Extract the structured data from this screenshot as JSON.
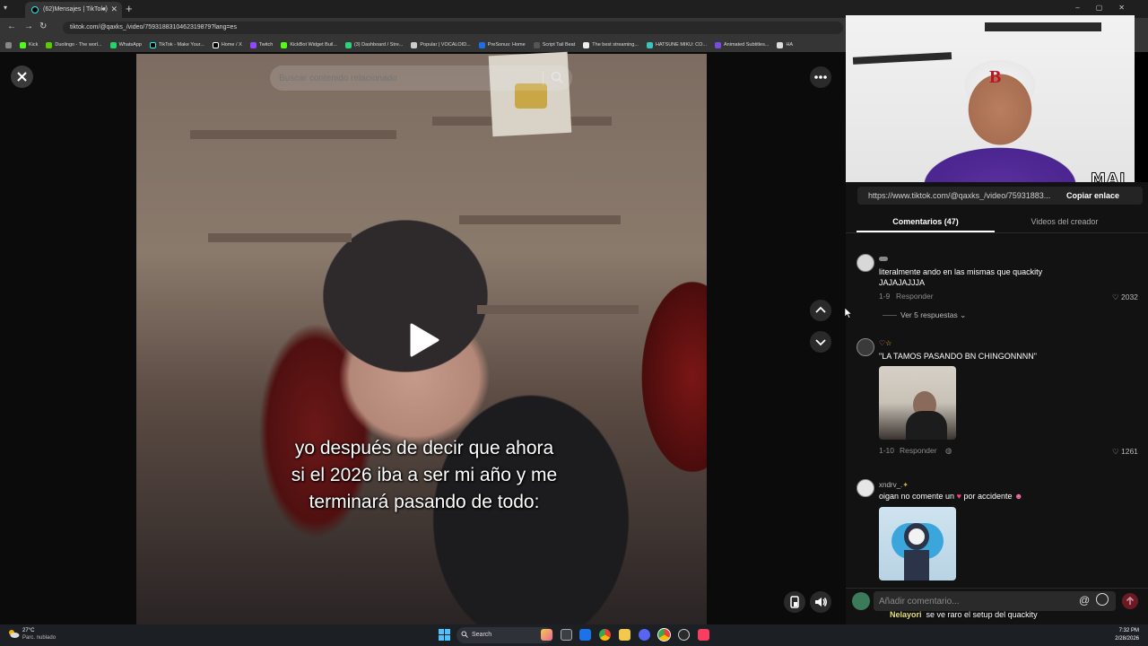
{
  "browser": {
    "tab_title": "(62)Mensajes | TikTok",
    "url": "tiktok.com/@qaxks_/video/7593188310462319879?lang=es",
    "bookmarks": [
      "Kick",
      "Duolingo - The worl...",
      "WhatsApp",
      "TikTok - Make Your...",
      "Home / X",
      "Twitch",
      "KickBot Widget Buil...",
      "(3) Dashboard / Stre...",
      "Popular | VOCALOID...",
      "PreSonus: Home",
      "Script Tail Beat",
      "The best streaming...",
      "HATSUNE MIKU: CO...",
      "Animated Subtitles...",
      "HA"
    ]
  },
  "player": {
    "search_placeholder": "Buscar contenido relacionado",
    "caption_lines": [
      "yo después de decir que ahora",
      "si el 2026 iba a ser mi año y me",
      "terminará pasando de todo:"
    ]
  },
  "webcam": {
    "tag": "MAI",
    "hat_logo": "B"
  },
  "panel": {
    "share_link": "https://www.tiktok.com/@qaxks_/video/75931883...",
    "copy_label": "Copiar enlace",
    "tab_comments": "Comentarios (47)",
    "tab_creator": "Videos del creador",
    "comments": [
      {
        "user": "",
        "text_line1": "literalmente ando en las mismas que quackity",
        "text_line2": "JAJAJAJJJA",
        "date": "1-9",
        "reply_label": "Responder",
        "likes": "2032",
        "replies": "Ver 5 respuestas"
      },
      {
        "user": "",
        "text_line1": "\"LA TAMOS PASANDO BN CHINGONNNN\"",
        "date": "1-10",
        "reply_label": "Responder",
        "likes": "1261"
      },
      {
        "user": "xndrv_.",
        "text_line1": "oigan no comente un",
        "text_line1b": "por accidente"
      }
    ],
    "comment_placeholder": "Añadir comentario...",
    "chat_overlay": {
      "name": "Nelayori",
      "message": "se ve raro el setup del quackity"
    }
  },
  "taskbar": {
    "weather_temp": "27°C",
    "weather_desc": "Parc. nublado",
    "search_label": "Search",
    "time": "7:32 PM",
    "date": "2/28/2026"
  },
  "colors": {
    "accent_red": "#fe2c55",
    "panel_bg": "#121212"
  }
}
